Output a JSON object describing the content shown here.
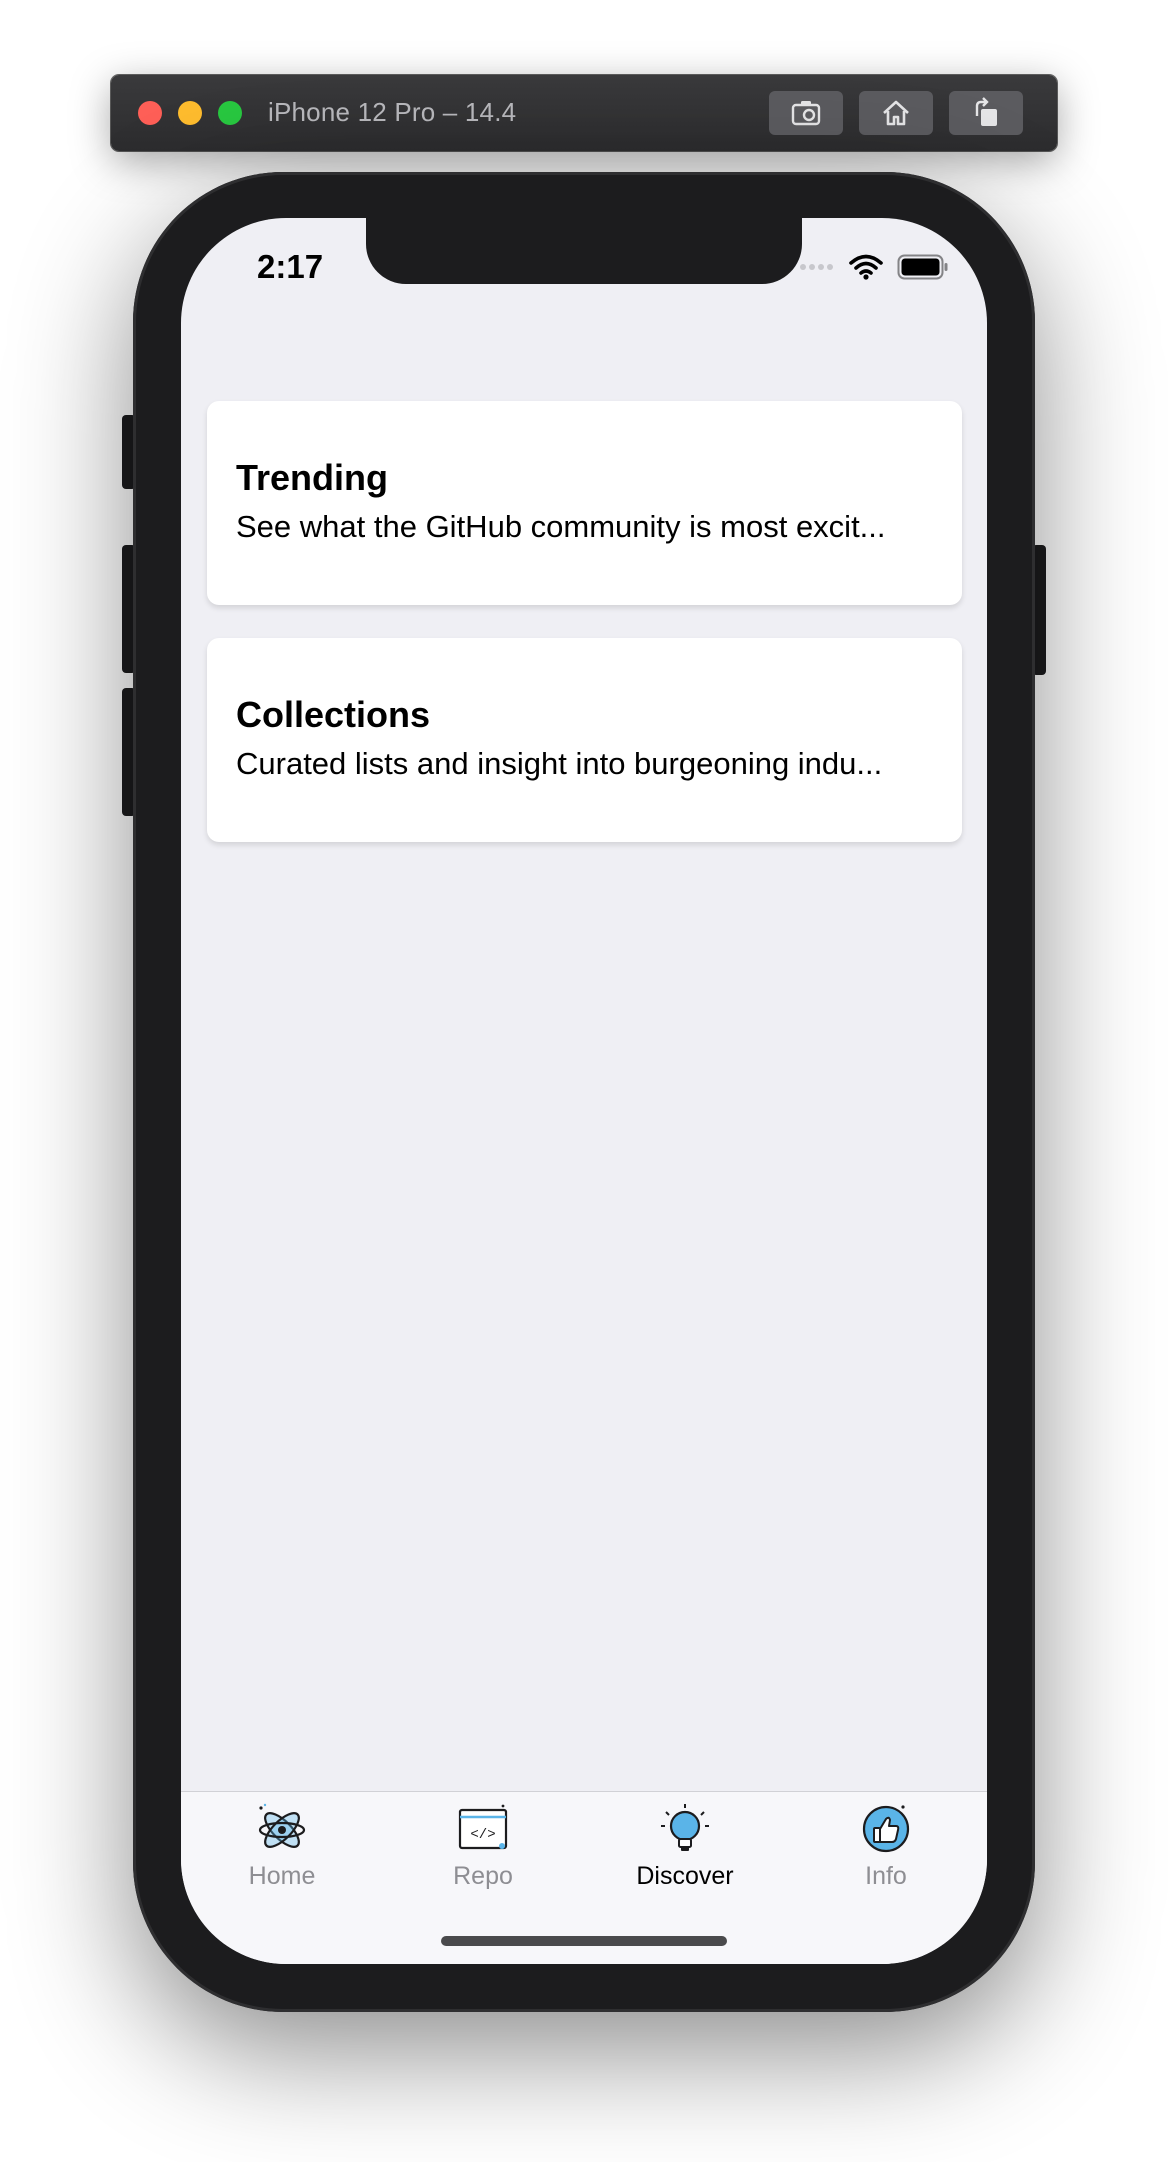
{
  "simulator": {
    "title": "iPhone 12 Pro – 14.4",
    "buttons": [
      "screenshot-icon",
      "home-icon",
      "rotate-icon"
    ]
  },
  "status_bar": {
    "time": "2:17"
  },
  "cards": [
    {
      "title": "Trending",
      "subtitle": "See what the GitHub community is most excit..."
    },
    {
      "title": "Collections",
      "subtitle": "Curated lists and insight into burgeoning indu..."
    }
  ],
  "tabbar": {
    "items": [
      {
        "label": "Home",
        "icon": "atom-icon",
        "active": false
      },
      {
        "label": "Repo",
        "icon": "code-window-icon",
        "active": false
      },
      {
        "label": "Discover",
        "icon": "lightbulb-icon",
        "active": true
      },
      {
        "label": "Info",
        "icon": "thumbs-up-icon",
        "active": false
      }
    ]
  },
  "colors": {
    "screen_background": "#efeff4",
    "accent_icon": "#5ab4e8",
    "tab_inactive": "#8e8e93"
  }
}
